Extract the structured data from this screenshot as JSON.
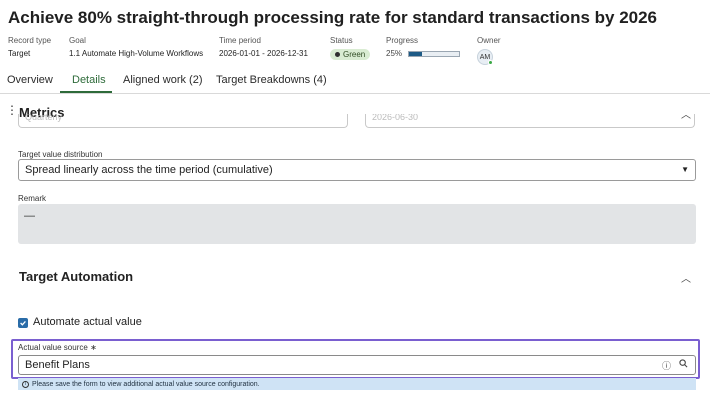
{
  "header": {
    "title": "Achieve 80% straight-through processing rate for standard transactions by 2026",
    "meta": {
      "record_type_label": "Record type",
      "record_type_value": "Target",
      "goal_label": "Goal",
      "goal_value": "1.1 Automate High-Volume Workflows",
      "time_period_label": "Time period",
      "time_period_value": "2026-01-01 - 2026-12-31",
      "status_label": "Status",
      "status_value": "Green",
      "progress_label": "Progress",
      "progress_value": "25%",
      "progress_fraction": 0.25,
      "owner_label": "Owner",
      "owner_initials": "AM"
    }
  },
  "tabs": [
    {
      "label": "Overview"
    },
    {
      "label": "Details"
    },
    {
      "label": "Aligned work (2)"
    },
    {
      "label": "Target Breakdowns (4)"
    }
  ],
  "metrics": {
    "section_title": "Metrics",
    "cut_left_value": "Quarterly",
    "cut_right_value": "2026-06-30",
    "distribution_label": "Target value distribution",
    "distribution_value": "Spread linearly across the time period (cumulative)",
    "remark_label": "Remark",
    "remark_value": "—"
  },
  "automation": {
    "section_title": "Target Automation",
    "checkbox_label": "Automate actual value",
    "source_label": "Actual value source",
    "required_mark": "∗",
    "source_value": "Benefit Plans",
    "info_message": "Please save the form to view additional actual value source configuration."
  },
  "colors": {
    "accent": "#2e6b3a",
    "highlight": "#7a5fd0",
    "info_bg": "#cfe3f5",
    "checkbox": "#2a6ca8"
  }
}
